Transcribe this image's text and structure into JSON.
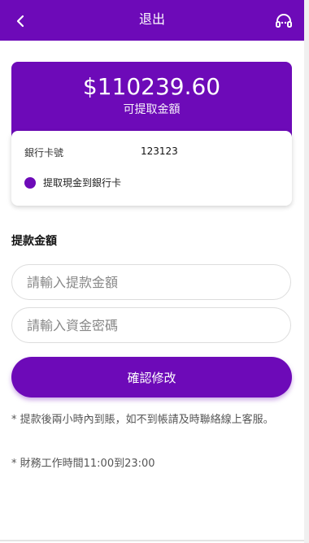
{
  "header": {
    "title": "退出",
    "back_icon": "chevron-left-icon",
    "support_icon": "headset-icon"
  },
  "balance": {
    "amount": "$110239.60",
    "label": "可提取金額"
  },
  "bank": {
    "label": "銀行卡號",
    "value": "123123",
    "option_label": "提取現金到銀行卡",
    "option_selected": true
  },
  "form": {
    "section_title": "提款金額",
    "amount_placeholder": "請輸入提款金額",
    "password_placeholder": "請輸入資金密碼",
    "submit_label": "確認修改"
  },
  "notes": {
    "note1": "* 提款後兩小時內到賬，如不到帳請及時聯絡線上客服。",
    "note2": "* 財務工作時間11:00到23:00"
  },
  "colors": {
    "primary": "#6d0ab8"
  }
}
